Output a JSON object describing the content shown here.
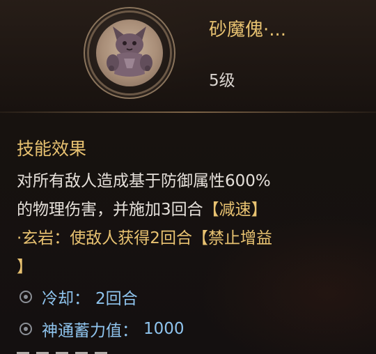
{
  "skill": {
    "name": "砂魔傀·...",
    "level": "5级"
  },
  "effect": {
    "title": "技能效果",
    "line1": "对所有敌人造成基于防御属性600%",
    "line2a": "的物理伤害，并施加3回合",
    "line2b": "【减速】",
    "line3a": "·玄岩：使敌人获得2回合",
    "line3b": "【禁止增益",
    "line4": "】"
  },
  "stats": [
    {
      "label": "冷却：",
      "value": "2回合"
    },
    {
      "label": "神通蓄力值：",
      "value": "1000"
    }
  ],
  "colors": {
    "gold": "#e8c271",
    "blue": "#8fc4ee",
    "text": "#e5e0da"
  },
  "icons": {
    "skill_icon": "stone-golem-icon",
    "bullet": "swirl-bullet-icon"
  }
}
